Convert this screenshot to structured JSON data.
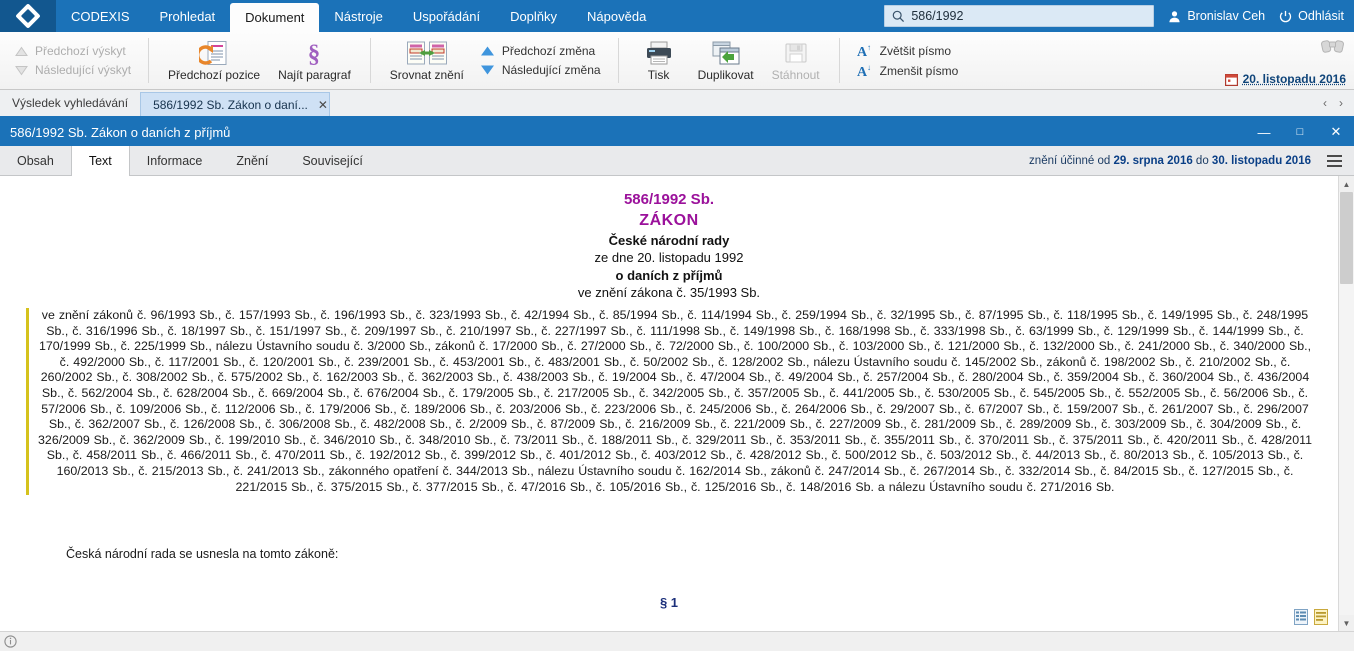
{
  "menubar": {
    "logo_icon": "codexis-diamond-logo",
    "items": [
      {
        "label": "CODEXIS",
        "active": false
      },
      {
        "label": "Prohledat",
        "active": false
      },
      {
        "label": "Dokument",
        "active": true
      },
      {
        "label": "Nástroje",
        "active": false
      },
      {
        "label": "Uspořádání",
        "active": false
      },
      {
        "label": "Doplňky",
        "active": false
      },
      {
        "label": "Nápověda",
        "active": false
      }
    ],
    "search": {
      "value": "586/1992",
      "placeholder": "",
      "icon": "search-icon"
    },
    "user": {
      "name": "Bronislav Ceh",
      "icon": "user-icon"
    },
    "logout": {
      "label": "Odhlásit",
      "icon": "power-icon"
    }
  },
  "ribbon": {
    "nav_prev": "Předchozí výskyt",
    "nav_next": "Následující výskyt",
    "prev_position": "Předchozí pozice",
    "find_paragraph": "Najít paragraf",
    "compare": "Srovnat znění",
    "change_prev": "Předchozí změna",
    "change_next": "Následující změna",
    "print": "Tisk",
    "duplicate": "Duplikovat",
    "download": "Stáhnout",
    "font_increase": "Zvětšit písmo",
    "font_decrease": "Zmenšit písmo",
    "binoculars_icon": "binoculars-icon",
    "date_label": "20. listopadu 2016",
    "date_icon": "calendar-icon"
  },
  "tabstrip": {
    "results_label": "Výsledek vyhledávání",
    "doc_tab": "586/1992 Sb. Zákon o daní...",
    "close_glyph": "✕",
    "nav_left": "‹",
    "nav_right": "›"
  },
  "docwindow": {
    "title": "586/1992 Sb. Zákon o daních z příjmů",
    "minimize": "—",
    "maximize": "□",
    "close": "✕"
  },
  "innertabs": {
    "items": [
      {
        "label": "Obsah",
        "active": false
      },
      {
        "label": "Text",
        "active": true
      },
      {
        "label": "Informace",
        "active": false
      },
      {
        "label": "Znění",
        "active": false
      },
      {
        "label": "Související",
        "active": false
      }
    ],
    "validity_prefix": "znění účinné od ",
    "validity_from": "29. srpna 2016",
    "validity_mid": " do ",
    "validity_to": "30. listopadu 2016",
    "menu_icon": "hamburger-menu-icon"
  },
  "document": {
    "number": "586/1992 Sb.",
    "kind": "ZÁKON",
    "authority": "České národní rady",
    "date_line": "ze dne 20. listopadu 1992",
    "subject": "o daních z příjmů",
    "version_line": "ve znění zákona č. 35/1993 Sb.",
    "amendments": "ve znění zákonů č. 96/1993 Sb., č. 157/1993 Sb., č. 196/1993 Sb., č. 323/1993 Sb., č. 42/1994 Sb., č. 85/1994 Sb., č. 114/1994 Sb., č. 259/1994 Sb., č. 32/1995 Sb., č. 87/1995 Sb., č. 118/1995 Sb., č. 149/1995 Sb., č. 248/1995 Sb., č. 316/1996 Sb., č. 18/1997 Sb., č. 151/1997 Sb., č. 209/1997 Sb., č. 210/1997 Sb., č. 227/1997 Sb., č. 111/1998 Sb., č. 149/1998 Sb., č. 168/1998 Sb., č. 333/1998 Sb., č. 63/1999 Sb., č. 129/1999 Sb., č. 144/1999 Sb., č. 170/1999 Sb., č. 225/1999 Sb., nálezu Ústavního soudu č. 3/2000 Sb., zákonů č. 17/2000 Sb., č. 27/2000 Sb., č. 72/2000 Sb., č. 100/2000 Sb., č. 103/2000 Sb., č. 121/2000 Sb., č. 132/2000 Sb., č. 241/2000 Sb., č. 340/2000 Sb., č. 492/2000 Sb., č. 117/2001 Sb., č. 120/2001 Sb., č. 239/2001 Sb., č. 453/2001 Sb., č. 483/2001 Sb., č. 50/2002 Sb., č. 128/2002 Sb., nálezu Ústavního soudu č. 145/2002 Sb., zákonů č. 198/2002 Sb., č. 210/2002 Sb., č. 260/2002 Sb., č. 308/2002 Sb., č. 575/2002 Sb., č. 162/2003 Sb., č. 362/2003 Sb., č. 438/2003 Sb., č. 19/2004 Sb., č. 47/2004 Sb., č. 49/2004 Sb., č. 257/2004 Sb., č. 280/2004 Sb., č. 359/2004 Sb., č. 360/2004 Sb., č. 436/2004 Sb., č. 562/2004 Sb., č. 628/2004 Sb., č. 669/2004 Sb., č. 676/2004 Sb., č. 179/2005 Sb., č. 217/2005 Sb., č. 342/2005 Sb., č. 357/2005 Sb., č. 441/2005 Sb., č. 530/2005 Sb., č. 545/2005 Sb., č. 552/2005 Sb., č. 56/2006 Sb., č. 57/2006 Sb., č. 109/2006 Sb., č. 112/2006 Sb., č. 179/2006 Sb., č. 189/2006 Sb., č. 203/2006 Sb., č. 223/2006 Sb., č. 245/2006 Sb., č. 264/2006 Sb., č. 29/2007 Sb., č. 67/2007 Sb., č. 159/2007 Sb., č. 261/2007 Sb., č. 296/2007 Sb., č. 362/2007 Sb., č. 126/2008 Sb., č. 306/2008 Sb., č. 482/2008 Sb., č. 2/2009 Sb., č. 87/2009 Sb., č. 216/2009 Sb., č. 221/2009 Sb., č. 227/2009 Sb., č. 281/2009 Sb., č. 289/2009 Sb., č. 303/2009 Sb., č. 304/2009 Sb., č. 326/2009 Sb., č. 362/2009 Sb., č. 199/2010 Sb., č. 346/2010 Sb., č. 348/2010 Sb., č. 73/2011 Sb., č. 188/2011 Sb., č. 329/2011 Sb., č. 353/2011 Sb., č. 355/2011 Sb., č. 370/2011 Sb., č. 375/2011 Sb., č. 420/2011 Sb., č. 428/2011 Sb., č. 458/2011 Sb., č. 466/2011 Sb., č. 470/2011 Sb., č. 192/2012 Sb., č. 399/2012 Sb., č. 401/2012 Sb., č. 403/2012 Sb., č. 428/2012 Sb., č. 500/2012 Sb., č. 503/2012 Sb., č. 44/2013 Sb., č. 80/2013 Sb., č. 105/2013 Sb., č. 160/2013 Sb., č. 215/2013 Sb., č. 241/2013 Sb., zákonného opatření č. 344/2013 Sb., nálezu Ústavního soudu č. 162/2014 Sb., zákonů č. 247/2014 Sb., č. 267/2014 Sb., č. 332/2014 Sb., č. 84/2015 Sb., č. 127/2015 Sb., č. 221/2015 Sb., č. 375/2015 Sb., č. 377/2015 Sb., č. 47/2016 Sb., č. 105/2016 Sb., č. 125/2016 Sb., č. 148/2016 Sb. a nálezu Ústavního soudu č. 271/2016 Sb.",
    "intro": "Česká národní rada se usnesla na tomto zákoně:",
    "first_section": "§ 1"
  },
  "statusbar": {
    "info_icon": "info-icon"
  },
  "colors": {
    "brand_blue": "#1b72b8",
    "accent_purple": "#9b119b",
    "amend_bar_yellow": "#d5c21d",
    "section_blue": "#1b2f7a"
  }
}
